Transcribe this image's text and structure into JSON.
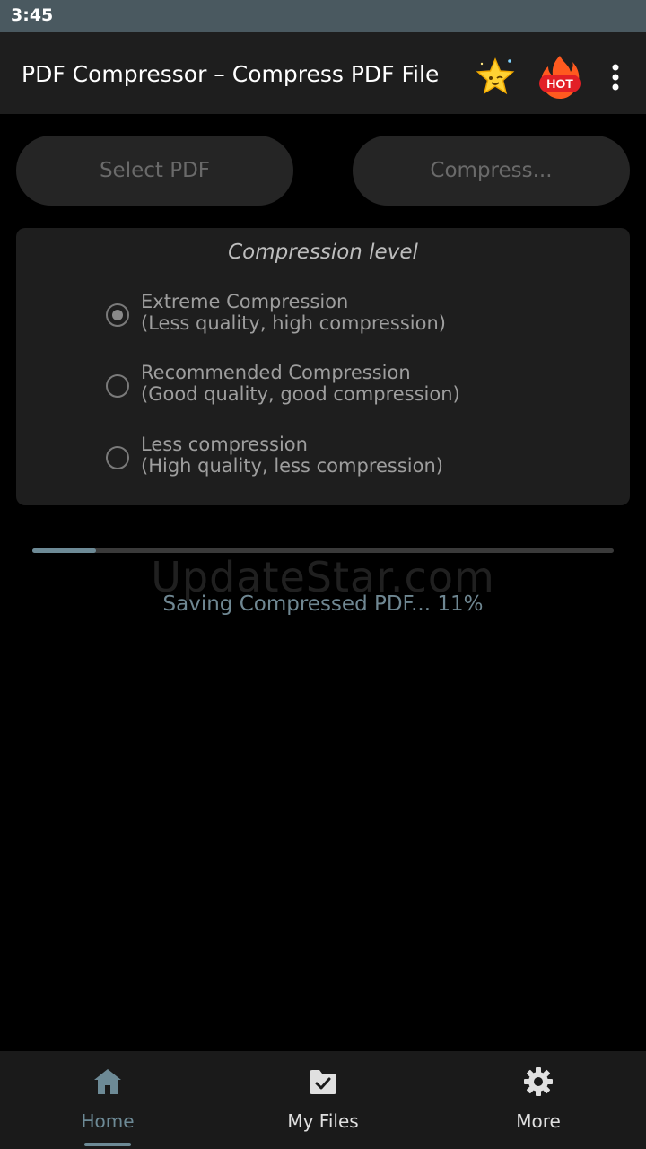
{
  "status_bar": {
    "time": "3:45"
  },
  "app_bar": {
    "title": "PDF Compressor – Compress PDF File",
    "hot_badge": "HOT",
    "icons": [
      "star-icon",
      "hot-icon",
      "more-vert-icon"
    ]
  },
  "actions": {
    "select_label": "Select PDF",
    "compress_label": "Compress..."
  },
  "compression": {
    "title": "Compression level",
    "options": [
      {
        "line1": "Extreme Compression",
        "line2": "(Less quality, high compression)",
        "selected": true
      },
      {
        "line1": "Recommended Compression",
        "line2": "(Good quality, good compression)",
        "selected": false
      },
      {
        "line1": "Less compression",
        "line2": "(High quality, less compression)",
        "selected": false
      }
    ]
  },
  "progress": {
    "value_percent": 11,
    "text": "Saving Compressed PDF... 11%"
  },
  "watermark": "UpdateStar.com",
  "bottom_nav": {
    "items": [
      {
        "label": "Home",
        "icon": "home-icon",
        "active": true
      },
      {
        "label": "My Files",
        "icon": "folder-check-icon",
        "active": false
      },
      {
        "label": "More",
        "icon": "gear-icon",
        "active": false
      }
    ]
  },
  "colors": {
    "accent": "#6d8a96",
    "status_bar": "#4a5960",
    "surface": "#1e1e1e",
    "background": "#000000"
  }
}
